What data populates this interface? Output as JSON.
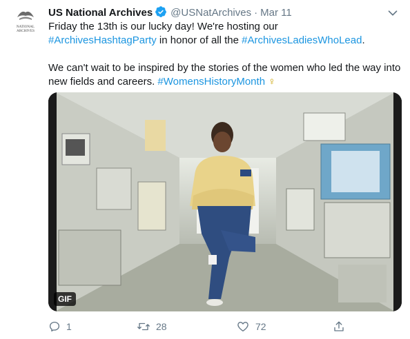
{
  "account": {
    "name": "US National Archives",
    "handle": "@USNatArchives",
    "separator": "·",
    "date": "Mar 11",
    "avatar_text_line1": "NATIONAL",
    "avatar_text_line2": "ARCHIVES"
  },
  "tweet": {
    "line1": "Friday the 13th is our lucky day! We're hosting our",
    "hashtag1": "#ArchivesHashtagParty",
    "line2_mid": " in honor of all the ",
    "hashtag2": "#ArchivesLadiesWhoLead",
    "line2_end": ".",
    "para2": "We can't wait to be inspired by the stories of the women who led the way into new fields and careers. ",
    "hashtag3": "#WomensHistoryMonth",
    "emoji": "♀"
  },
  "media": {
    "badge": "GIF",
    "description": "Astronaut in yellow shirt and blue pants floating in spacecraft lab"
  },
  "actions": {
    "reply_count": "1",
    "retweet_count": "28",
    "like_count": "72"
  },
  "icons": {
    "verified": "verified-badge-icon",
    "caret": "chevron-down-icon",
    "reply": "reply-icon",
    "retweet": "retweet-icon",
    "like": "heart-icon",
    "share": "share-icon"
  },
  "colors": {
    "link": "#1b95e0",
    "muted": "#657786",
    "text": "#14171a",
    "verified": "#1da1f2"
  }
}
